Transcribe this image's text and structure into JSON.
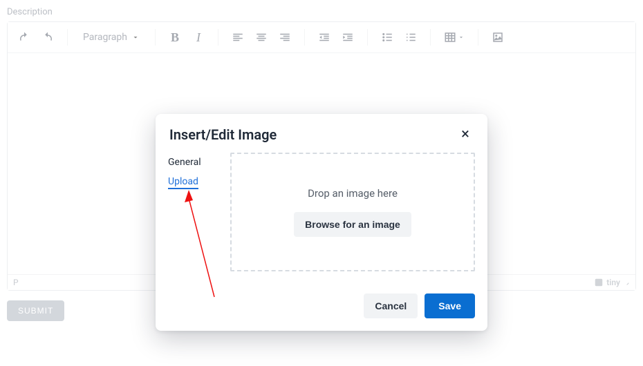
{
  "field": {
    "label": "Description"
  },
  "toolbar": {
    "format_label": "Paragraph"
  },
  "status": {
    "path": "P",
    "brand": "tiny"
  },
  "submit": {
    "label": "SUBMIT"
  },
  "dialog": {
    "title": "Insert/Edit Image",
    "tabs": {
      "general": "General",
      "upload": "Upload"
    },
    "dropzone": {
      "text": "Drop an image here",
      "browse": "Browse for an image"
    },
    "actions": {
      "cancel": "Cancel",
      "save": "Save"
    }
  }
}
